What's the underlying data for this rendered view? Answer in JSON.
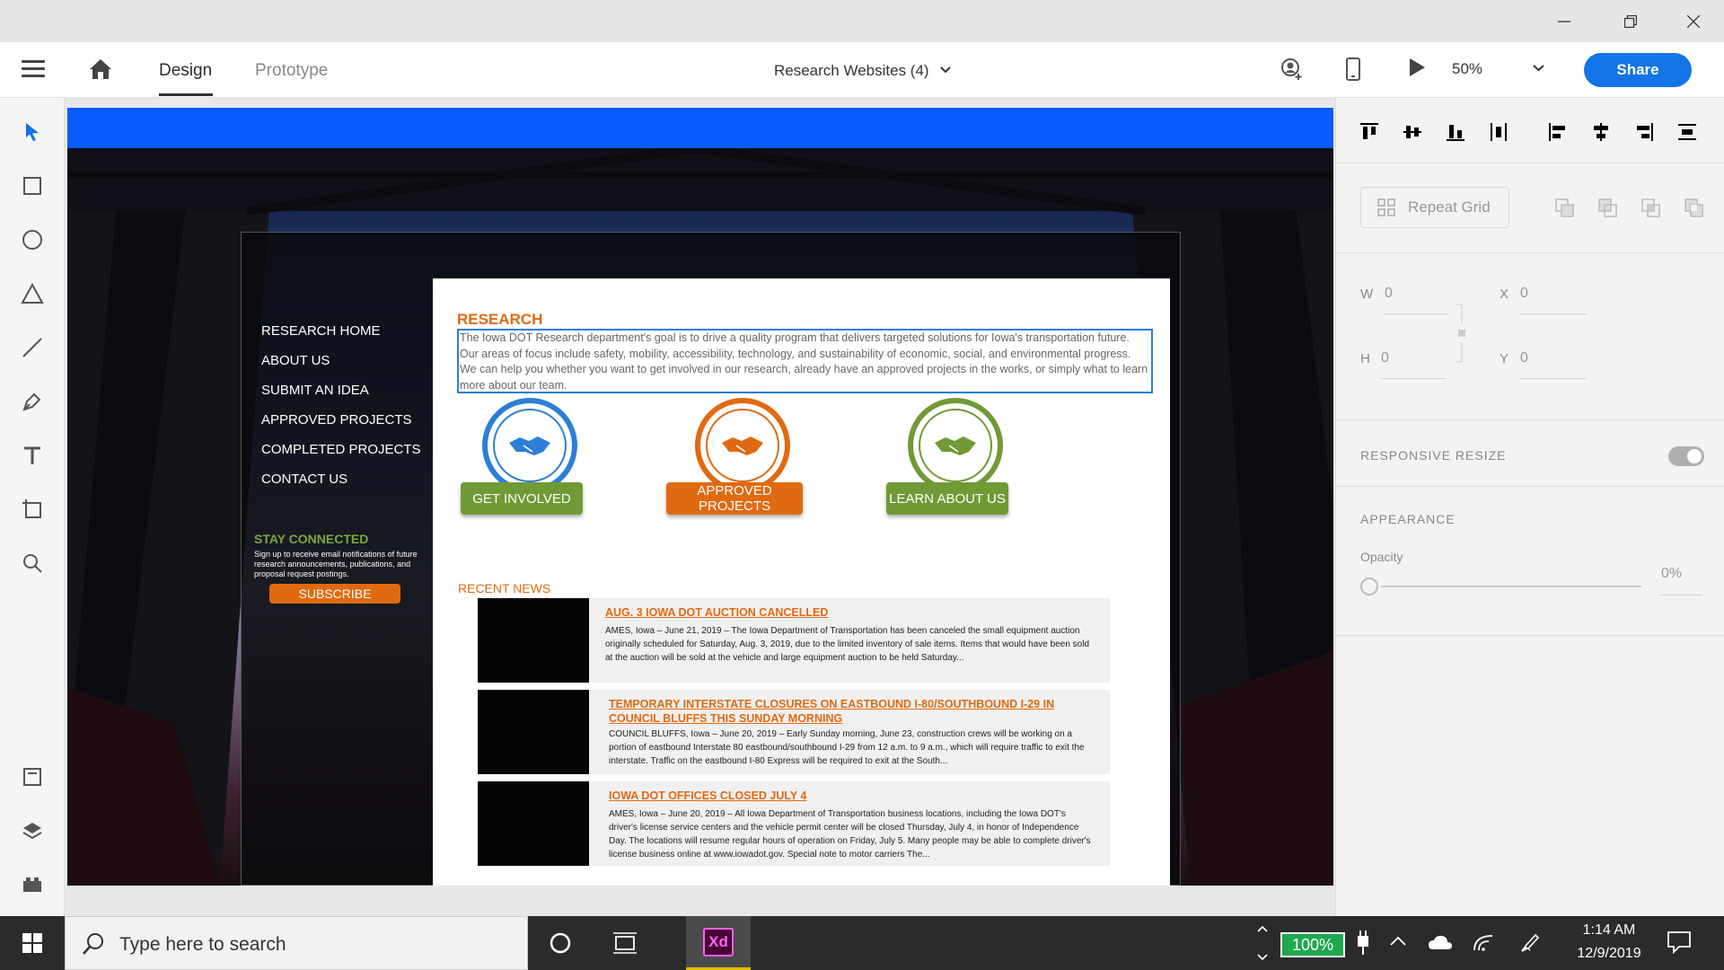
{
  "colors": {
    "accent": "#1473e6",
    "site_orange": "#e06a12",
    "site_green": "#7ea63f",
    "site_blue": "#2c7fd6",
    "artboard_bar": "#0a5cff"
  },
  "header": {
    "modes": [
      "Design",
      "Prototype"
    ],
    "active_mode": "Design",
    "document_title": "Research Websites (4)",
    "zoom": "50%",
    "share_label": "Share"
  },
  "toolbar": {
    "tools": [
      "select-icon",
      "rectangle-icon",
      "ellipse-icon",
      "triangle-icon",
      "line-icon",
      "pen-icon",
      "text-icon",
      "artboard-icon",
      "zoom-icon"
    ],
    "bottom_tools": [
      "assets-icon",
      "layers-icon",
      "plugins-icon"
    ]
  },
  "site": {
    "nav": [
      "RESEARCH HOME",
      "ABOUT US",
      "SUBMIT AN IDEA",
      "APPROVED PROJECTS",
      "COMPLETED PROJECTS",
      "CONTACT US"
    ],
    "stay_title": "STAY CONNECTED",
    "stay_text": "Sign up to receive email notifications of future research announcements, publications, and proposal request postings.",
    "subscribe_label": "SUBSCRIBE",
    "research_title": "RESEARCH",
    "research_text": "The Iowa DOT Research department's goal is to drive a quality program that delivers targeted solutions for Iowa's transportation future. Our areas of focus include safety, mobility, accessibility, technology, and sustainability of economic, social, and environmental progress. We can help you whether you want to get involved in our research, already have an approved projects in the works, or simply what to learn more about our team.",
    "cta": [
      {
        "label": "GET INVOLVED",
        "color": "#6f9a35",
        "ring": "#2c7fd6"
      },
      {
        "label": "APPROVED PROJECTS",
        "color": "#e06a12",
        "ring": "#e06a12"
      },
      {
        "label": "LEARN ABOUT US",
        "color": "#6f9a35",
        "ring": "#6f9a35"
      }
    ],
    "news_title": "RECENT NEWS",
    "news": [
      {
        "headline": "AUG. 3 IOWA DOT AUCTION CANCELLED",
        "body": "AMES, Iowa – June 21, 2019 – The Iowa Department of Transportation has been canceled the small equipment auction originally scheduled for Saturday, Aug. 3, 2019, due to the limited inventory of sale items. Items that would have been sold at the auction will be sold at the vehicle and large equipment auction to be held Saturday..."
      },
      {
        "headline": "TEMPORARY INTERSTATE CLOSURES ON EASTBOUND I-80/SOUTHBOUND I-29 IN COUNCIL BLUFFS THIS SUNDAY MORNING",
        "body": "COUNCIL BLUFFS, Iowa – June 20, 2019 – Early Sunday morning, June 23, construction crews will be working on a portion of eastbound Interstate 80 eastbound/southbound I-29 from 12 a.m. to 9 a.m., which will require traffic to exit the interstate. Traffic on the eastbound I-80 Express will be required to exit at the South..."
      },
      {
        "headline": "IOWA DOT OFFICES CLOSED JULY 4",
        "body": "AMES, Iowa – June 20, 2019 – All Iowa Department of Transportation business locations, including the Iowa DOT's driver's license service centers and the vehicle permit center will be closed Thursday, July 4, in honor of Independence Day. The locations will resume regular hours of operation on Friday, July 5. Many people may be able to complete driver's license business online at www.iowadot.gov. Special note to motor carriers The..."
      }
    ]
  },
  "inspector": {
    "repeat_grid_label": "Repeat Grid",
    "w_label": "W",
    "w_value": "0",
    "h_label": "H",
    "h_value": "0",
    "x_label": "X",
    "x_value": "0",
    "y_label": "Y",
    "y_value": "0",
    "responsive_label": "RESPONSIVE RESIZE",
    "appearance_label": "APPEARANCE",
    "opacity_label": "Opacity",
    "opacity_value": "0%"
  },
  "taskbar": {
    "search_placeholder": "Type here to search",
    "battery": "100%",
    "time": "1:14 AM",
    "date": "12/9/2019",
    "xd_label": "Xd"
  }
}
